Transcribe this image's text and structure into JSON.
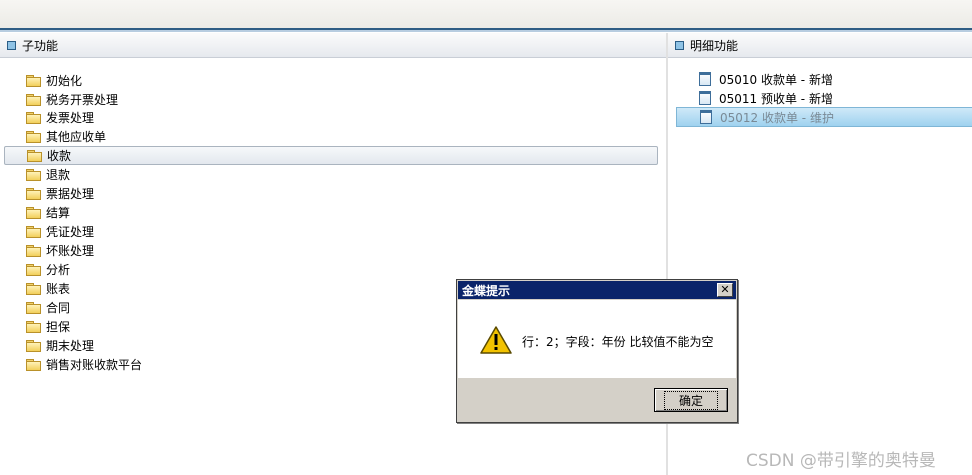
{
  "left_panel": {
    "title": "子功能",
    "items": [
      {
        "label": "初始化"
      },
      {
        "label": "税务开票处理"
      },
      {
        "label": "发票处理"
      },
      {
        "label": "其他应收单"
      },
      {
        "label": "收款",
        "selected": true
      },
      {
        "label": "退款"
      },
      {
        "label": "票据处理"
      },
      {
        "label": "结算"
      },
      {
        "label": "凭证处理"
      },
      {
        "label": "坏账处理"
      },
      {
        "label": "分析"
      },
      {
        "label": "账表"
      },
      {
        "label": "合同"
      },
      {
        "label": "担保"
      },
      {
        "label": "期末处理"
      },
      {
        "label": "销售对账收款平台"
      }
    ]
  },
  "right_panel": {
    "title": "明细功能",
    "items": [
      {
        "label": "05010  收款单 - 新增"
      },
      {
        "label": "05011  预收单 - 新增"
      },
      {
        "label": "05012  收款单 - 维护",
        "selected": true
      }
    ]
  },
  "dialog": {
    "title": "金蝶提示",
    "close_glyph": "✕",
    "message": "行：2；字段：年份 比较值不能为空",
    "ok_label": "确定"
  },
  "watermark": "CSDN @带引擎的奥特曼",
  "colors": {
    "title_bar": "#0a246a",
    "dialog_bg": "#d4d0c8",
    "selection": "#9fd2ef",
    "header_square": "#8fc3e6"
  }
}
